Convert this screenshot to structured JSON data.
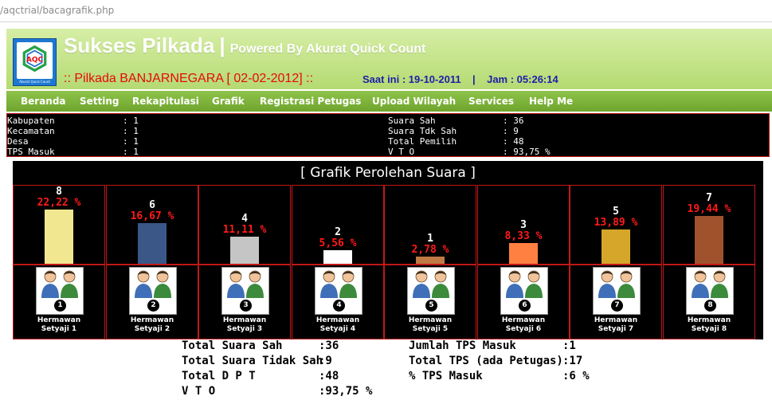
{
  "browser": {
    "url": "/aqctrial/bacagrafik.php"
  },
  "header": {
    "logo_text": "AQC",
    "logo_caption": "Akurat Quick Count",
    "title": "Sukses Pilkada",
    "separator": "|",
    "powered": "Powered By Akurat Quick Count",
    "pilkada": ":: Pilkada BANJARNEGARA [ 02-02-2012] ::",
    "datetime": "Saat ini : 19-10-2011    |    Jam : 05:26:14"
  },
  "nav": [
    "Beranda",
    "Setting",
    "Rekapitulasi",
    "Grafik",
    "Registrasi Petugas",
    "Upload Wilayah",
    "Services",
    "Help Me"
  ],
  "stats_left": [
    {
      "label": "Kabupaten",
      "value": ": 1"
    },
    {
      "label": "Kecamatan",
      "value": ": 1"
    },
    {
      "label": "Desa",
      "value": ": 1"
    },
    {
      "label": "TPS Masuk",
      "value": ": 1"
    }
  ],
  "stats_right": [
    {
      "label": "Suara Sah",
      "value": ": 36"
    },
    {
      "label": "Suara Tdk Sah",
      "value": ": 9"
    },
    {
      "label": "Total Pemilih",
      "value": ": 48"
    },
    {
      "label": "V T O",
      "value": ": 93,75 %"
    }
  ],
  "chart_data": {
    "type": "bar",
    "title": "[ Grafik Perolehan Suara ]",
    "categories": [
      "Hermawan Setyaji 1",
      "Hermawan Setyaji 2",
      "Hermawan Setyaji 3",
      "Hermawan Setyaji 4",
      "Hermawan Setyaji 5",
      "Hermawan Setyaji 6",
      "Hermawan Setyaji 7",
      "Hermawan Setyaji 8"
    ],
    "values": [
      8,
      6,
      4,
      2,
      1,
      3,
      5,
      7
    ],
    "percent_labels": [
      "22,22 %",
      "16,67 %",
      "11,11 %",
      "5,56 %",
      "2,78 %",
      "8,33 %",
      "13,89 %",
      "19,44 %"
    ],
    "colors": [
      "#f1e791",
      "#3a5788",
      "#c5c5c5",
      "#ffffff",
      "#c07a45",
      "#ff8040",
      "#d5a62a",
      "#a0522d"
    ],
    "numbers": [
      "1",
      "2",
      "3",
      "4",
      "5",
      "6",
      "7",
      "8"
    ],
    "candidate_first": "Hermawan",
    "candidate_second": [
      "Setyaji 1",
      "Setyaji 2",
      "Setyaji 3",
      "Setyaji 4",
      "Setyaji 5",
      "Setyaji 6",
      "Setyaji 7",
      "Setyaji 8"
    ]
  },
  "summary": [
    {
      "label": "Total Suara Sah",
      "value": ":36"
    },
    {
      "label": "Total Suara Tidak Sah",
      "value": ":9"
    },
    {
      "label": "Total D P T",
      "value": ":48"
    },
    {
      "label": "V T O",
      "value": ":93,75 %"
    }
  ],
  "summary_right": [
    {
      "label": "Jumlah TPS Masuk",
      "value": ":1"
    },
    {
      "label": "Total TPS (ada Petugas)",
      "value": ":17"
    },
    {
      "label": "% TPS Masuk",
      "value": ":6 %"
    }
  ]
}
